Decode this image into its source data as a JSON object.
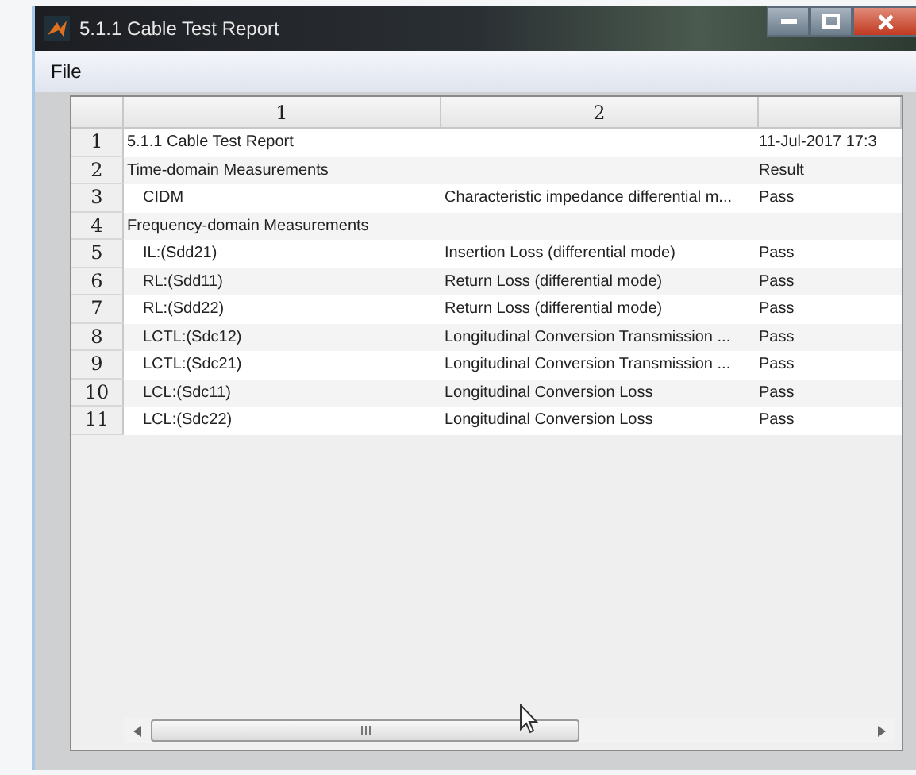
{
  "window": {
    "title": "5.1.1 Cable Test Report"
  },
  "menu": [
    "File"
  ],
  "table": {
    "columns": [
      "1",
      "2"
    ],
    "rows": [
      {
        "number": "1",
        "cells": [
          "5.1.1 Cable Test Report",
          "",
          "11-Jul-2017 17:3"
        ]
      },
      {
        "number": "2",
        "cells": [
          "Time-domain Measurements",
          "",
          "Result"
        ],
        "children": [
          {
            "number": "3",
            "cells": [
              "CIDM",
              "Characteristic impedance differential m...",
              "Pass"
            ]
          }
        ]
      },
      {
        "number": "4",
        "cells": [
          "Frequency-domain Measurements",
          "",
          ""
        ],
        "children": [
          {
            "number": "5",
            "cells": [
              "IL:(Sdd21)",
              "Insertion Loss (differential mode)",
              "Pass"
            ]
          },
          {
            "number": "6",
            "cells": [
              "RL:(Sdd11)",
              "Return Loss (differential mode)",
              "Pass"
            ]
          },
          {
            "number": "7",
            "cells": [
              "RL:(Sdd22)",
              "Return Loss (differential mode)",
              "Pass"
            ]
          },
          {
            "number": "8",
            "cells": [
              "LCTL:(Sdc12)",
              "Longitudinal Conversion Transmission ...",
              "Pass"
            ]
          },
          {
            "number": "9",
            "cells": [
              "LCTL:(Sdc21)",
              "Longitudinal Conversion Transmission ...",
              "Pass"
            ]
          },
          {
            "number": "10",
            "cells": [
              "LCL:(Sdc11)",
              "Longitudinal Conversion Loss",
              "Pass"
            ]
          },
          {
            "number": "11",
            "cells": [
              "LCL:(Sdc22)",
              "Longitudinal Conversion Loss",
              "Pass"
            ]
          }
        ]
      }
    ]
  }
}
